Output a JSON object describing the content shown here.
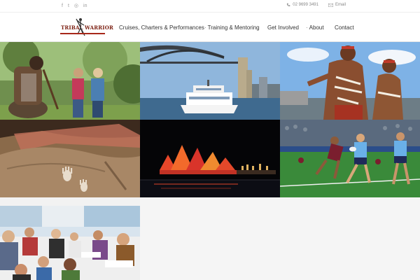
{
  "social": {
    "icons": [
      "facebook-icon",
      "twitter-icon",
      "instagram-icon",
      "linkedin-icon"
    ],
    "glyphs": [
      "f",
      "t",
      "◎",
      "in"
    ]
  },
  "contact": {
    "phone": "02 9699 3491",
    "email": "Email"
  },
  "logo": {
    "left_text": "TRIBAL",
    "right_text": "WARRIOR"
  },
  "nav": {
    "items": [
      {
        "label": "Cruises, Charters & Performances",
        "dot": ""
      },
      {
        "label": "Training & Mentoring",
        "dot": "·"
      },
      {
        "label": "Get Involved",
        "dot": ""
      },
      {
        "label": "About",
        "dot": "·"
      },
      {
        "label": "Contact",
        "dot": ""
      }
    ]
  },
  "colors": {
    "brand": "#7a1d0f",
    "accent": "#a8281a",
    "text": "#333333",
    "muted": "#9a9a9a"
  },
  "gallery": {
    "tiles": [
      {
        "name": "tile-aboriginal-guide-tour"
      },
      {
        "name": "tile-harbour-cruise-boat"
      },
      {
        "name": "tile-aboriginal-performers"
      },
      {
        "name": "tile-rock-art-handprints"
      },
      {
        "name": "tile-opera-house-vivid"
      },
      {
        "name": "tile-rugby-league-match"
      },
      {
        "name": "tile-dining-cruise-guests"
      }
    ]
  }
}
